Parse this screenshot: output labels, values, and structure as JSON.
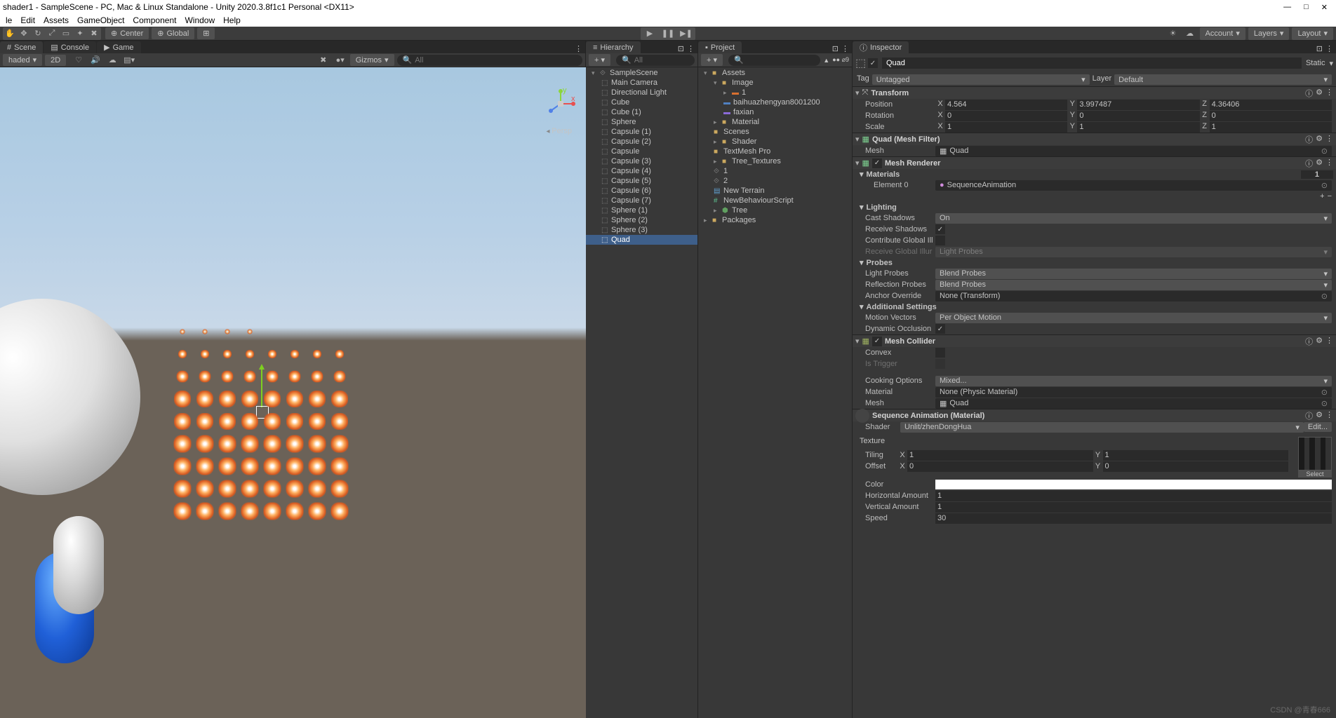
{
  "window": {
    "title": "shader1 - SampleScene - PC, Mac & Linux Standalone - Unity 2020.3.8f1c1 Personal <DX11>"
  },
  "menu": [
    "le",
    "Edit",
    "Assets",
    "GameObject",
    "Component",
    "Window",
    "Help"
  ],
  "toolbar": {
    "center": "Center",
    "global": "Global",
    "account": "Account",
    "layers": "Layers",
    "layout": "Layout"
  },
  "tabs": {
    "scene": "Scene",
    "console": "Console",
    "game": "Game",
    "hierarchy": "Hierarchy",
    "project": "Project",
    "inspector": "Inspector"
  },
  "sceneBar": {
    "shaded": "haded",
    "2d": "2D",
    "gizmos": "Gizmos",
    "allPh": "All",
    "persp": "Persp"
  },
  "hierarchy": {
    "scene": "SampleScene",
    "items": [
      "Main Camera",
      "Directional Light",
      "Cube",
      "Cube (1)",
      "Sphere",
      "Capsule (1)",
      "Capsule (2)",
      "Capsule",
      "Capsule (3)",
      "Capsule (4)",
      "Capsule (5)",
      "Capsule (6)",
      "Capsule (7)",
      "Sphere (1)",
      "Sphere (2)",
      "Sphere (3)",
      "Quad"
    ]
  },
  "project": {
    "assets": "Assets",
    "image": "Image",
    "item1": "1",
    "baihua": "baihuazhengyan8001200",
    "faxian": "faxian",
    "material": "Material",
    "scenes": "Scenes",
    "shader": "Shader",
    "tmp": "TextMesh Pro",
    "treeTex": "Tree_Textures",
    "one": "1",
    "two": "2",
    "terrain": "New Terrain",
    "nbs": "NewBehaviourScript",
    "tree": "Tree",
    "packages": "Packages"
  },
  "inspector": {
    "name": "Quad",
    "static": "Static",
    "tag": "Tag",
    "tagVal": "Untagged",
    "layer": "Layer",
    "layerVal": "Default",
    "transform": {
      "title": "Transform",
      "position": "Position",
      "rotation": "Rotation",
      "scale": "Scale",
      "px": "4.564",
      "py": "3.997487",
      "pz": "4.36406",
      "rx": "0",
      "ry": "0",
      "rz": "0",
      "sx": "1",
      "sy": "1",
      "sz": "1",
      "X": "X",
      "Y": "Y",
      "Z": "Z"
    },
    "meshFilter": {
      "title": "Quad (Mesh Filter)",
      "mesh": "Mesh",
      "meshVal": "Quad"
    },
    "meshRenderer": {
      "title": "Mesh Renderer",
      "materials": "Materials",
      "count": "1",
      "element0": "Element 0",
      "elVal": "SequenceAnimation",
      "lighting": "Lighting",
      "castShadows": "Cast Shadows",
      "on": "On",
      "receiveShadows": "Receive Shadows",
      "contributeGI": "Contribute Global Ill",
      "receiveGI": "Receive Global Illur",
      "lightProbes": "Light Probes",
      "probes": "Probes",
      "lp": "Light Probes",
      "lpVal": "Blend Probes",
      "rp": "Reflection Probes",
      "rpVal": "Blend Probes",
      "anchor": "Anchor Override",
      "anchorVal": "None (Transform)",
      "additional": "Additional Settings",
      "motion": "Motion Vectors",
      "motionVal": "Per Object Motion",
      "dynOcc": "Dynamic Occlusion"
    },
    "meshCollider": {
      "title": "Mesh Collider",
      "convex": "Convex",
      "isTrigger": "Is Trigger",
      "cooking": "Cooking Options",
      "cookingVal": "Mixed...",
      "material": "Material",
      "materialVal": "None (Physic Material)",
      "mesh": "Mesh",
      "meshVal": "Quad"
    },
    "material": {
      "title": "Sequence Animation (Material)",
      "shader": "Shader",
      "shaderVal": "Unlit/zhenDongHua",
      "edit": "Edit...",
      "texture": "Texture",
      "tiling": "Tiling",
      "offset": "Offset",
      "X": "X",
      "Y": "Y",
      "tx": "1",
      "ty": "1",
      "ox": "0",
      "oy": "0",
      "select": "Select",
      "color": "Color",
      "horiz": "Horizontal Amount",
      "horizVal": "1",
      "vert": "Vertical Amount",
      "vertVal": "1",
      "speed": "Speed",
      "speedVal": "30"
    }
  },
  "watermark": "CSDN @青春666"
}
